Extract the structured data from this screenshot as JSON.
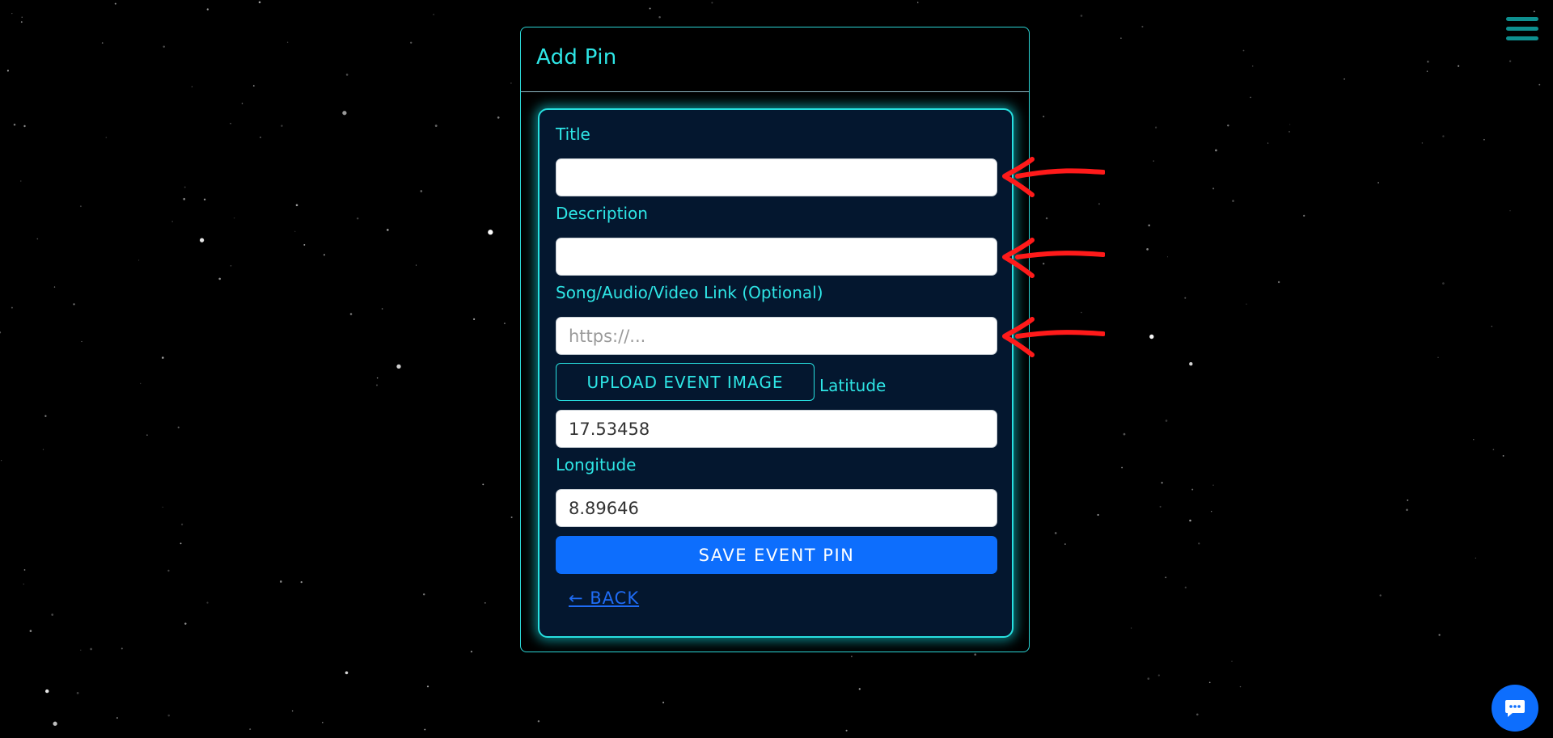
{
  "page": {
    "colors": {
      "background": "#000000",
      "accent_cyan": "#2ee6e6",
      "panel_bg": "#04172f",
      "primary_blue": "#0d6efd",
      "annotation_arrow": "#ff1a1a"
    }
  },
  "menu": {
    "icon": "hamburger-menu-icon"
  },
  "card": {
    "title": "Add Pin"
  },
  "form": {
    "title_label": "Title",
    "title_value": "",
    "description_label": "Description",
    "description_value": "",
    "link_label": "Song/Audio/Video Link (Optional)",
    "link_placeholder": "https://...",
    "link_value": "",
    "upload_label": "UPLOAD EVENT IMAGE",
    "latitude_label": "Latitude",
    "latitude_value": "17.53458",
    "longitude_label": "Longitude",
    "longitude_value": "8.89646",
    "save_label": "SAVE EVENT PIN",
    "back_label": "← BACK"
  },
  "annotations": {
    "arrow_icon": "red-arrow-icon"
  },
  "chat": {
    "icon": "chat-bubble-icon"
  }
}
